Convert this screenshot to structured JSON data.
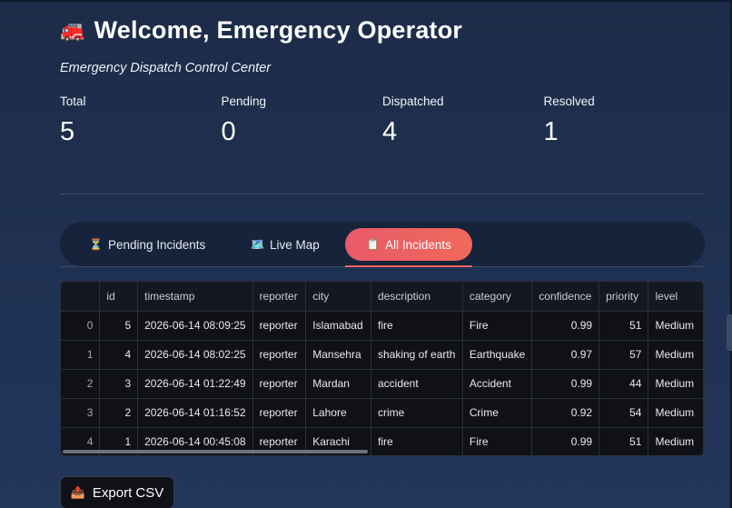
{
  "header": {
    "icon": "fire-engine-icon",
    "icon_glyph": "🚒",
    "title": "Welcome, Emergency Operator",
    "subtitle": "Emergency Dispatch Control Center"
  },
  "metrics": [
    {
      "label": "Total",
      "value": "5"
    },
    {
      "label": "Pending",
      "value": "0"
    },
    {
      "label": "Dispatched",
      "value": "4"
    },
    {
      "label": "Resolved",
      "value": "1"
    }
  ],
  "tabs": [
    {
      "icon": "hourglass-icon",
      "glyph": "⏳",
      "label": "Pending Incidents",
      "active": false
    },
    {
      "icon": "map-icon",
      "glyph": "🗺️",
      "label": "Live Map",
      "active": false
    },
    {
      "icon": "clipboard-icon",
      "glyph": "📋",
      "label": "All Incidents",
      "active": true
    }
  ],
  "table": {
    "columns": [
      "",
      "id",
      "timestamp",
      "reporter",
      "city",
      "description",
      "category",
      "confidence",
      "priority",
      "level"
    ],
    "rows": [
      [
        "0",
        "5",
        "2026-06-14 08:09:25",
        "reporter",
        "Islamabad",
        "fire",
        "Fire",
        "0.99",
        "51",
        "Medium"
      ],
      [
        "1",
        "4",
        "2026-06-14 08:02:25",
        "reporter",
        "Mansehra",
        "shaking of earth",
        "Earthquake",
        "0.97",
        "57",
        "Medium"
      ],
      [
        "2",
        "3",
        "2026-06-14 01:22:49",
        "reporter",
        "Mardan",
        "accident",
        "Accident",
        "0.99",
        "44",
        "Medium"
      ],
      [
        "3",
        "2",
        "2026-06-14 01:16:52",
        "reporter",
        "Lahore",
        "crime",
        "Crime",
        "0.92",
        "54",
        "Medium"
      ],
      [
        "4",
        "1",
        "2026-06-14 00:45:08",
        "reporter",
        "Karachi",
        "fire",
        "Fire",
        "0.99",
        "51",
        "Medium"
      ]
    ]
  },
  "export": {
    "icon": "outbox-tray-icon",
    "glyph": "📤",
    "label": "Export CSV"
  },
  "colors": {
    "active_tab": "#ef6461",
    "background": "#1f2f4d",
    "tab_bar": "#16233a",
    "table_bg": "#0f1117"
  }
}
